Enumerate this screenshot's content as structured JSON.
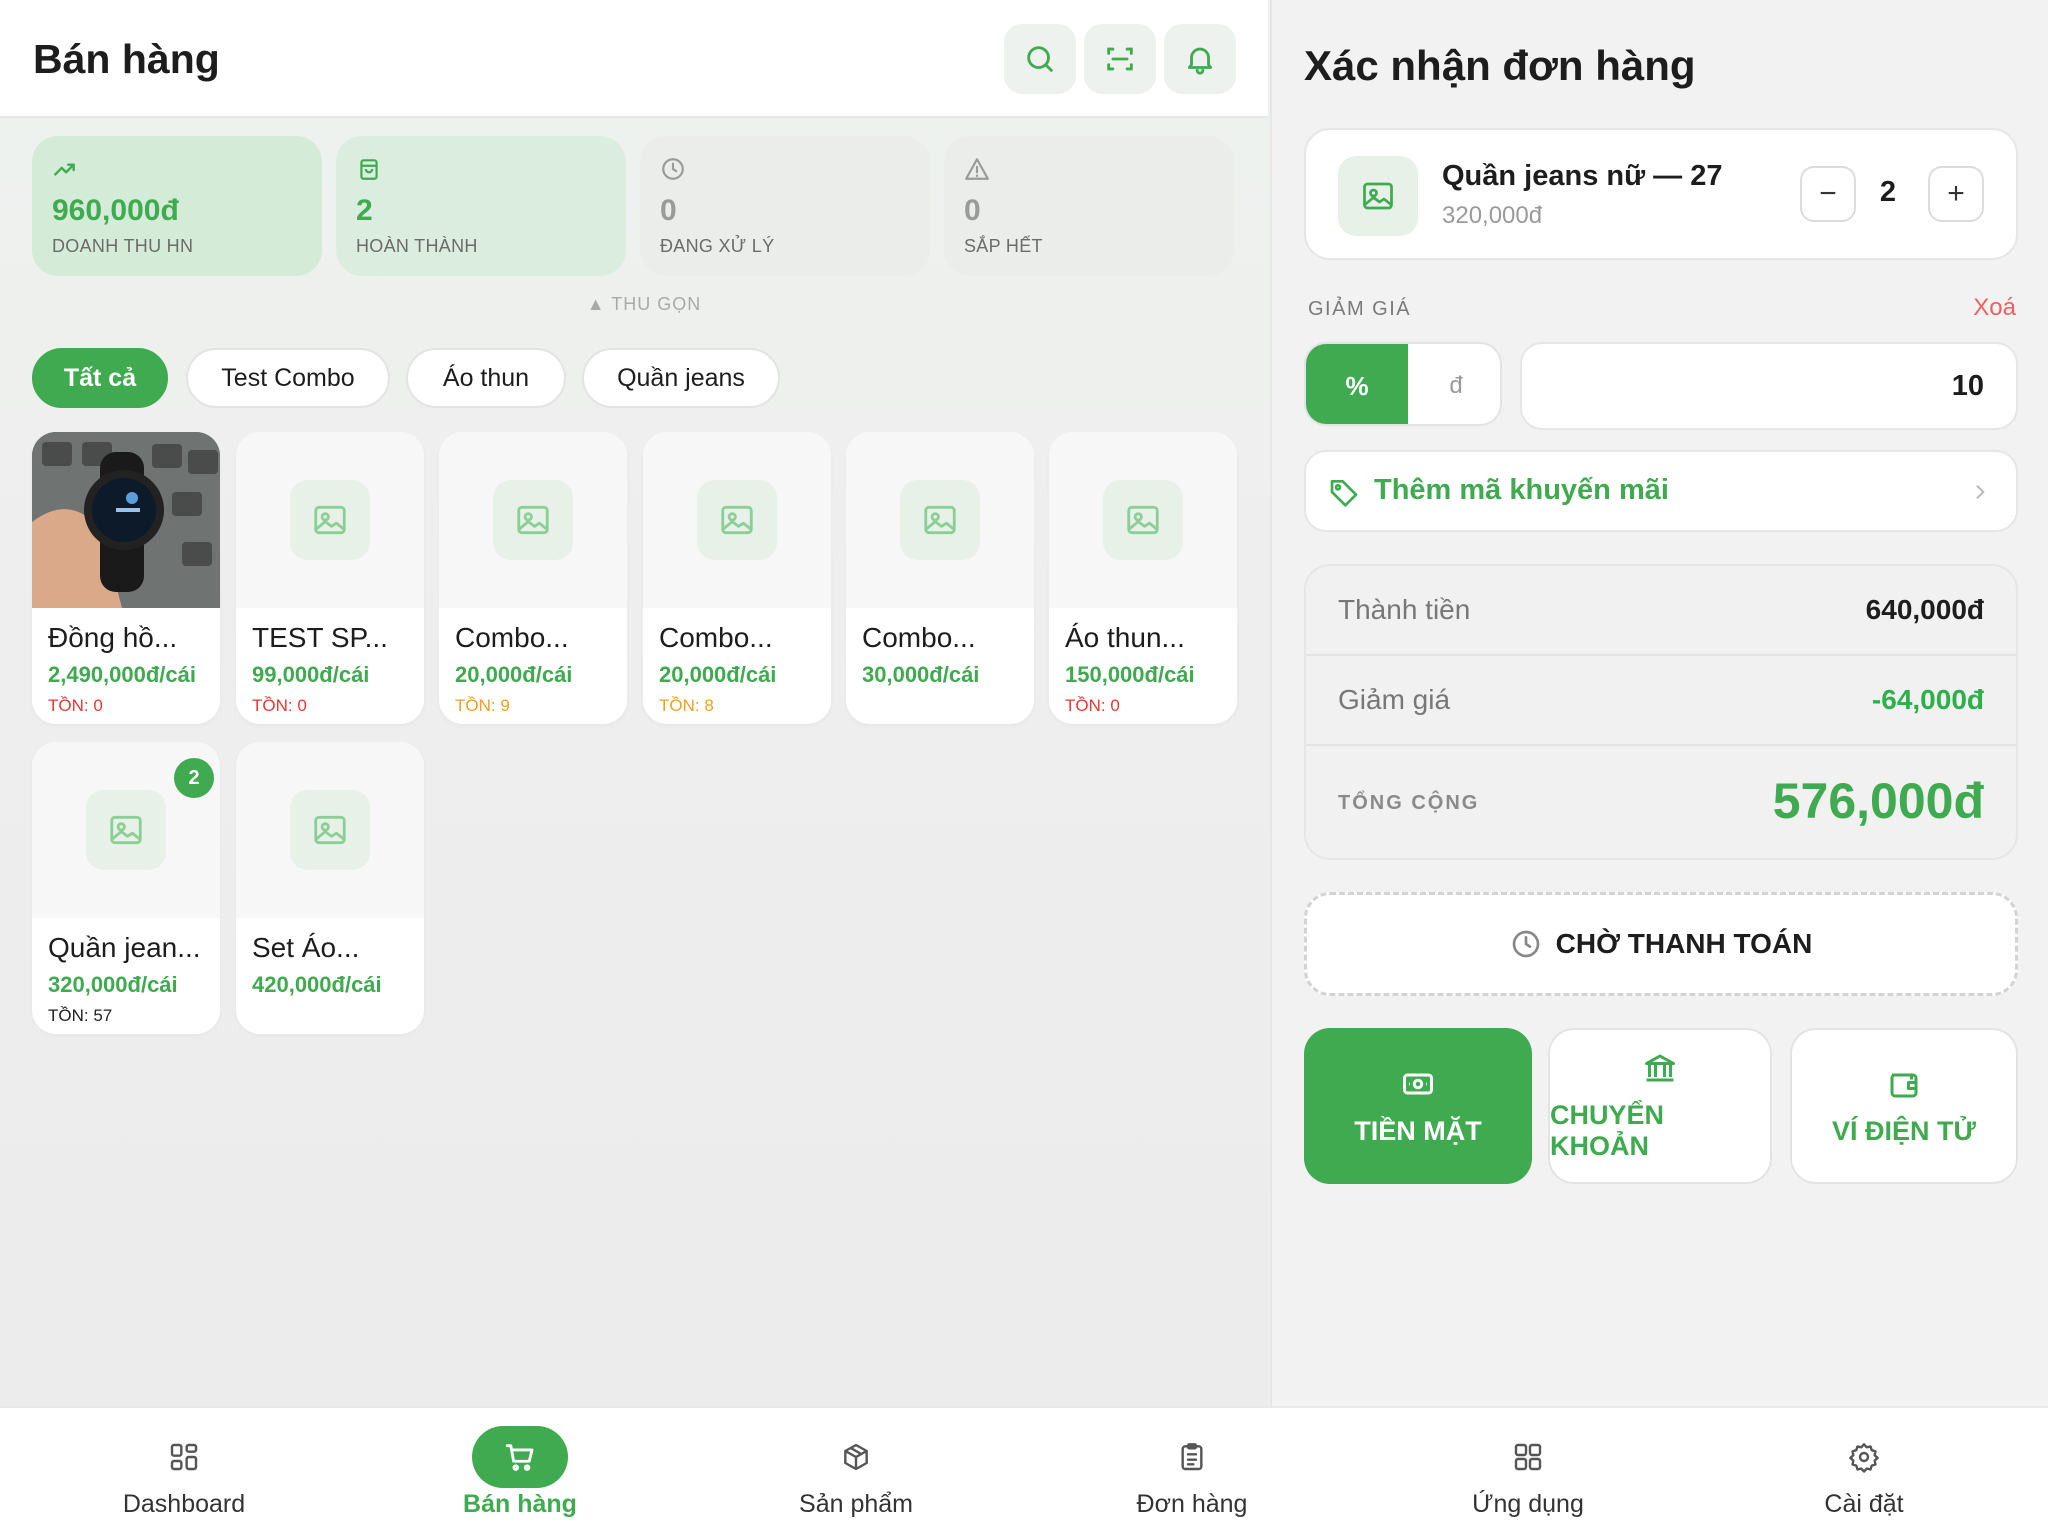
{
  "header": {
    "title": "Bán hàng"
  },
  "stats": [
    {
      "value": "960,000đ",
      "label": "DOANH THU HN"
    },
    {
      "value": "2",
      "label": "HOÀN THÀNH"
    },
    {
      "value": "0",
      "label": "ĐANG XỬ LÝ"
    },
    {
      "value": "0",
      "label": "SẮP HẾT"
    }
  ],
  "collapse_label": "▲ THU GỌN",
  "categories": [
    "Tất cả",
    "Test Combo",
    "Áo thun",
    "Quần jeans"
  ],
  "products": [
    {
      "name": "Đồng hồ...",
      "price": "2,490,000đ/cái",
      "stock": "TỒN: 0"
    },
    {
      "name": "TEST SP...",
      "price": "99,000đ/cái",
      "stock": "TỒN: 0"
    },
    {
      "name": "Combo...",
      "price": "20,000đ/cái",
      "stock": "TỒN: 9"
    },
    {
      "name": "Combo...",
      "price": "20,000đ/cái",
      "stock": "TỒN: 8"
    },
    {
      "name": "Combo...",
      "price": "30,000đ/cái",
      "stock": ""
    },
    {
      "name": "Áo thun...",
      "price": "150,000đ/cái",
      "stock": "TỒN: 0"
    },
    {
      "name": "Quần jean...",
      "price": "320,000đ/cái",
      "stock": "TỒN: 57",
      "badge": "2"
    },
    {
      "name": "Set Áo...",
      "price": "420,000đ/cái",
      "stock": ""
    }
  ],
  "colors": {
    "accent": "#3faa4f",
    "danger": "#e53935",
    "warning": "#f0a020",
    "delete": "#f06060"
  },
  "order": {
    "title": "Xác nhận đơn hàng",
    "item": {
      "name": "Quần jeans nữ — 27",
      "price": "320,000đ",
      "qty": "2"
    },
    "discount_label": "GIẢM GIÁ",
    "discount_clear": "Xoá",
    "discount_mode_percent": "%",
    "discount_mode_amount": "đ",
    "discount_value": "10",
    "promo_label": "Thêm mã khuyến mãi",
    "subtotal_label": "Thành tiền",
    "subtotal_value": "640,000đ",
    "discount_row_label": "Giảm giá",
    "discount_row_value": "-64,000đ",
    "total_label": "TỔNG CỘNG",
    "total_value": "576,000đ",
    "pending_label": "CHỜ THANH TOÁN",
    "payments": [
      "TIỀN MẶT",
      "CHUYỂN KHOẢN",
      "VÍ ĐIỆN TỬ"
    ]
  },
  "nav": [
    "Dashboard",
    "Bán hàng",
    "Sản phẩm",
    "Đơn hàng",
    "Ứng dụng",
    "Cài đặt"
  ]
}
